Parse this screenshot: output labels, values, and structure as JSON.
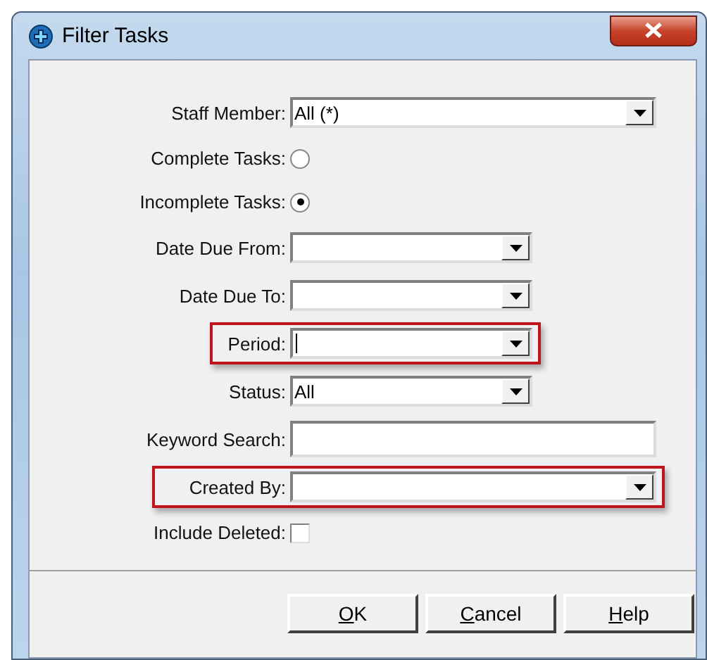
{
  "window": {
    "title": "Filter Tasks"
  },
  "fields": [
    {
      "kind": "combo",
      "label": "Staff Member:",
      "value": "All (*)",
      "wide": true,
      "highlighted": false,
      "focused": false
    },
    {
      "kind": "radio",
      "label": "Complete Tasks:",
      "selected": false
    },
    {
      "kind": "radio",
      "label": "Incomplete Tasks:",
      "selected": true
    },
    {
      "kind": "combo",
      "label": "Date Due From:",
      "wide": false,
      "highlighted": false,
      "focused": false
    },
    {
      "kind": "combo",
      "label": "Date Due To:",
      "wide": false,
      "highlighted": false,
      "focused": false
    },
    {
      "kind": "combo",
      "label": "Period:",
      "wide": false,
      "highlighted": true,
      "focused": true
    },
    {
      "kind": "combo",
      "label": "Status:",
      "value": "All",
      "wide": false,
      "highlighted": false,
      "focused": false
    },
    {
      "kind": "text",
      "label": "Keyword Search:",
      "wide": true,
      "highlighted": false
    },
    {
      "kind": "combo",
      "label": "Created By:",
      "wide": true,
      "highlighted": true,
      "focused": false
    },
    {
      "kind": "checkbox",
      "label": "Include Deleted:",
      "checked": false
    }
  ],
  "buttons": [
    {
      "label": "OK",
      "mnemonic_first": true
    },
    {
      "label": "Cancel",
      "mnemonic_first": true
    },
    {
      "label": "Help",
      "mnemonic_first": true
    }
  ]
}
